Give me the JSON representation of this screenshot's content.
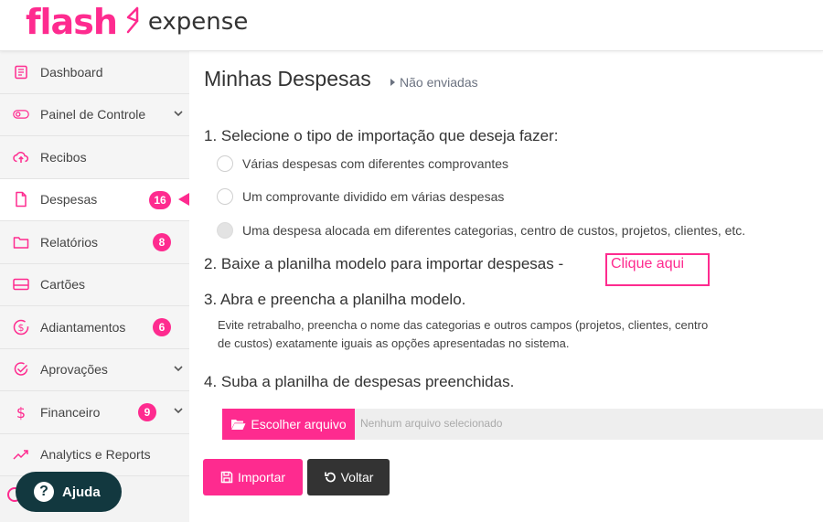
{
  "brand": {
    "name": "flash",
    "product": "expense",
    "accent": "#fe2b8f"
  },
  "sidebar": {
    "items": [
      {
        "label": "Dashboard",
        "icon": "dashboard-icon"
      },
      {
        "label": "Painel de Controle",
        "icon": "toggle-icon",
        "chevron": true
      },
      {
        "label": "Recibos",
        "icon": "cloud-upload-icon"
      },
      {
        "label": "Despesas",
        "icon": "document-icon",
        "badge": "16",
        "active": true
      },
      {
        "label": "Relatórios",
        "icon": "folder-icon",
        "badge": "8"
      },
      {
        "label": "Cartões",
        "icon": "card-icon"
      },
      {
        "label": "Adiantamentos",
        "icon": "dollar-circle-icon",
        "badge": "6"
      },
      {
        "label": "Aprovações",
        "icon": "check-circle-icon",
        "chevron": true
      },
      {
        "label": "Financeiro",
        "icon": "dollar-icon",
        "badge": "9",
        "chevron": true
      },
      {
        "label": "Analytics e Reports",
        "icon": "trend-icon"
      }
    ]
  },
  "help": {
    "label": "Ajuda",
    "glyph": "?"
  },
  "main": {
    "title": "Minhas Despesas",
    "breadcrumb": "Não enviadas",
    "step1": "1. Selecione o tipo de importação que deseja fazer:",
    "options": [
      "Várias despesas com diferentes comprovantes",
      "Um comprovante dividido em várias despesas",
      "Uma despesa alocada em diferentes categorias, centro de custos, projetos, clientes, etc."
    ],
    "step2": "2. Baixe a planilha modelo para importar despesas -",
    "step2_link": "Clique aqui",
    "step3": "3. Abra e preencha a planilha modelo.",
    "hint": "Evite retrabalho, preencha o nome das categorias e outros campos (projetos, clientes, centro de custos) exatamente iguais as opções apresentadas no sistema.",
    "step4": "4. Suba a planilha de despesas preenchidas.",
    "file_button": "Escolher arquivo",
    "file_status": "Nenhum arquivo selecionado",
    "import_button": "Importar",
    "back_button": "Voltar"
  }
}
